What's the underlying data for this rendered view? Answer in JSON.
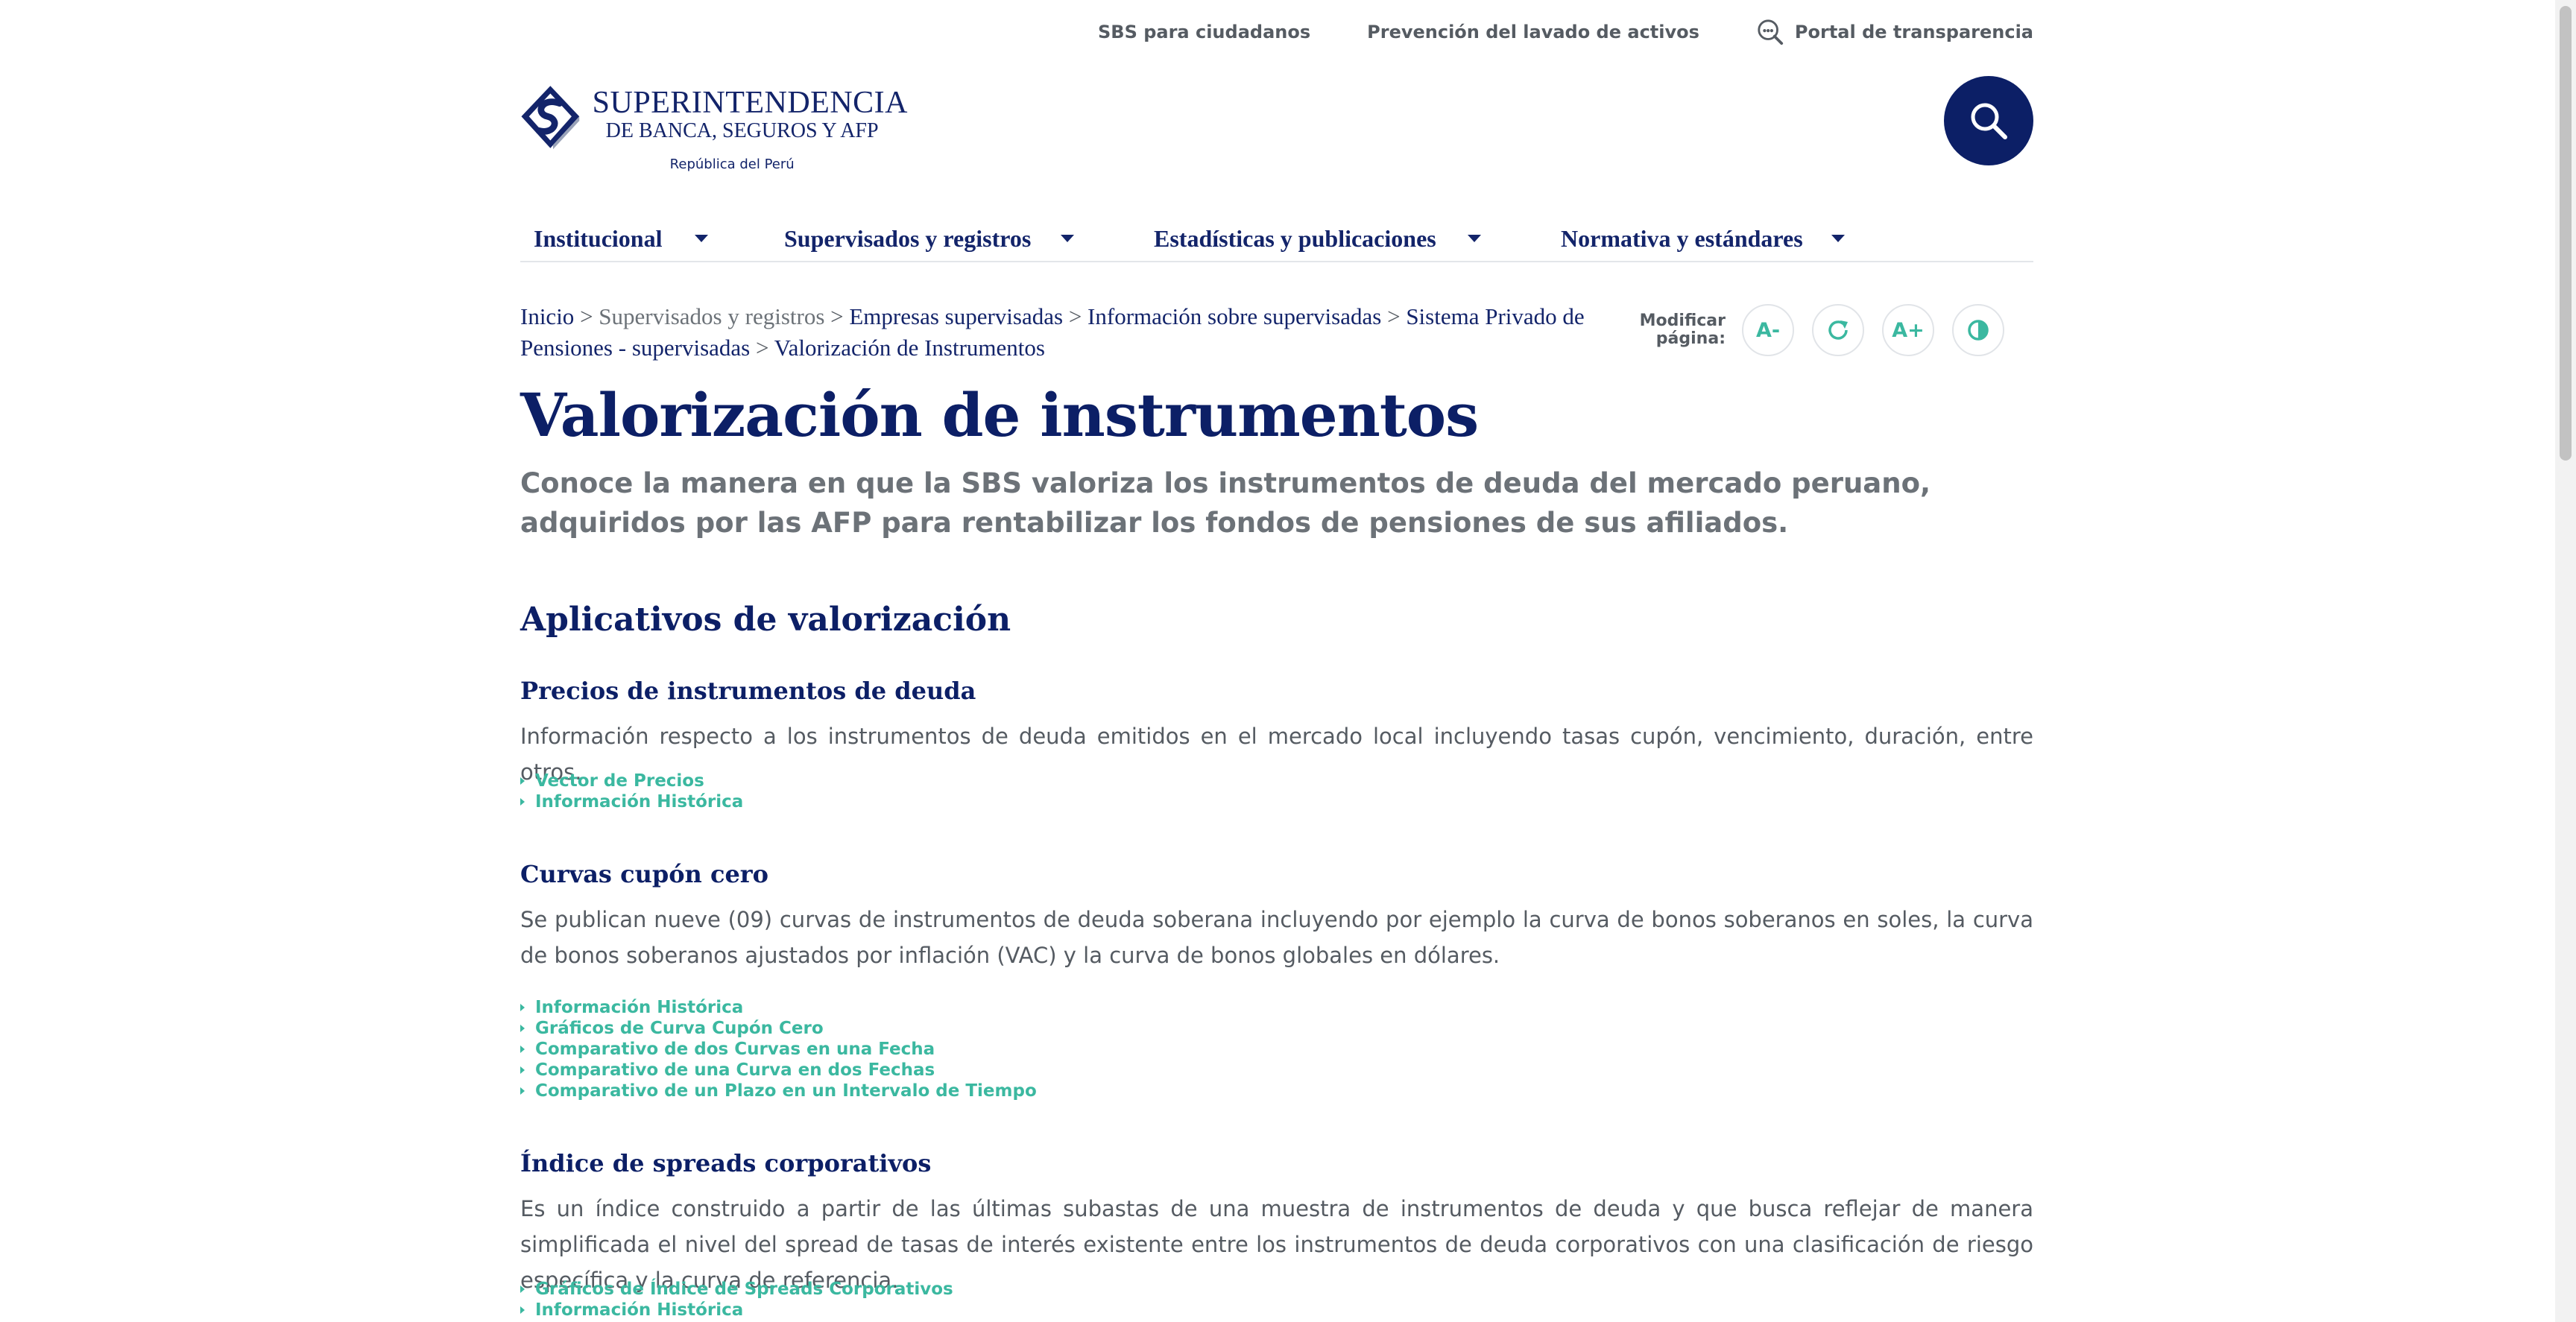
{
  "utility": {
    "citizens": "SBS para ciudadanos",
    "laundering": "Prevención del lavado de activos",
    "transparency": "Portal de transparencia"
  },
  "logo": {
    "line1": "SUPERINTENDENCIA",
    "line2": "DE BANCA, SEGUROS Y AFP",
    "line3": "República del Perú"
  },
  "nav": [
    {
      "label": "Institucional"
    },
    {
      "label": "Supervisados y registros"
    },
    {
      "label": "Estadísticas y publicaciones"
    },
    {
      "label": "Normativa y estándares"
    }
  ],
  "breadcrumb": {
    "home": "Inicio",
    "level1": "Supervisados y registros",
    "level2": "Empresas supervisadas",
    "level3": "Información sobre supervisadas",
    "level4": "Sistema Privado de Pensiones - supervisadas",
    "current": "Valorización de Instrumentos",
    "sep": ">"
  },
  "modify": {
    "label": "Modificar página:",
    "decrease": "A-",
    "increase": "A+"
  },
  "title": "Valorización de instrumentos",
  "subtitle": "Conoce la manera en que la SBS valoriza los instrumentos de deuda del mercado peruano, adquiridos por las AFP para rentabilizar los fondos de pensiones de sus afiliados.",
  "sections": {
    "apps_title": "Aplicativos de valorización",
    "prices": {
      "title": "Precios de instrumentos de deuda",
      "text": "Información respecto a los instrumentos de deuda emitidos en el mercado local incluyendo  tasas cupón, vencimiento, duración, entre otros.",
      "links": [
        "Vector de Precios",
        "Información Histórica"
      ]
    },
    "curves": {
      "title": "Curvas cupón cero",
      "text": "Se publican nueve (09) curvas de instrumentos de deuda soberana incluyendo por ejemplo la curva de bonos soberanos en soles, la curva de bonos soberanos ajustados por inflación (VAC) y la curva de bonos globales en dólares.",
      "links": [
        "Información Histórica",
        "Gráficos de Curva Cupón Cero",
        "Comparativo de dos Curvas en una Fecha",
        "Comparativo de una Curva en dos Fechas",
        "Comparativo de un Plazo en un Intervalo de Tiempo"
      ]
    },
    "spreads": {
      "title": "Índice de spreads corporativos",
      "text": "Es un índice construido a partir de las últimas subastas de una muestra de instrumentos de deuda y que busca reflejar de manera simplificada el nivel del spread de tasas de interés existente entre los instrumentos de deuda corporativos con una clasificación de riesgo específica y la curva  de referencia.",
      "links": [
        "Gráficos de Índice de Spreads Corporativos",
        "Información Histórica"
      ]
    }
  },
  "colors": {
    "navy": "#0c1f66",
    "teal": "#3bb8a0",
    "gray": "#555b62"
  }
}
